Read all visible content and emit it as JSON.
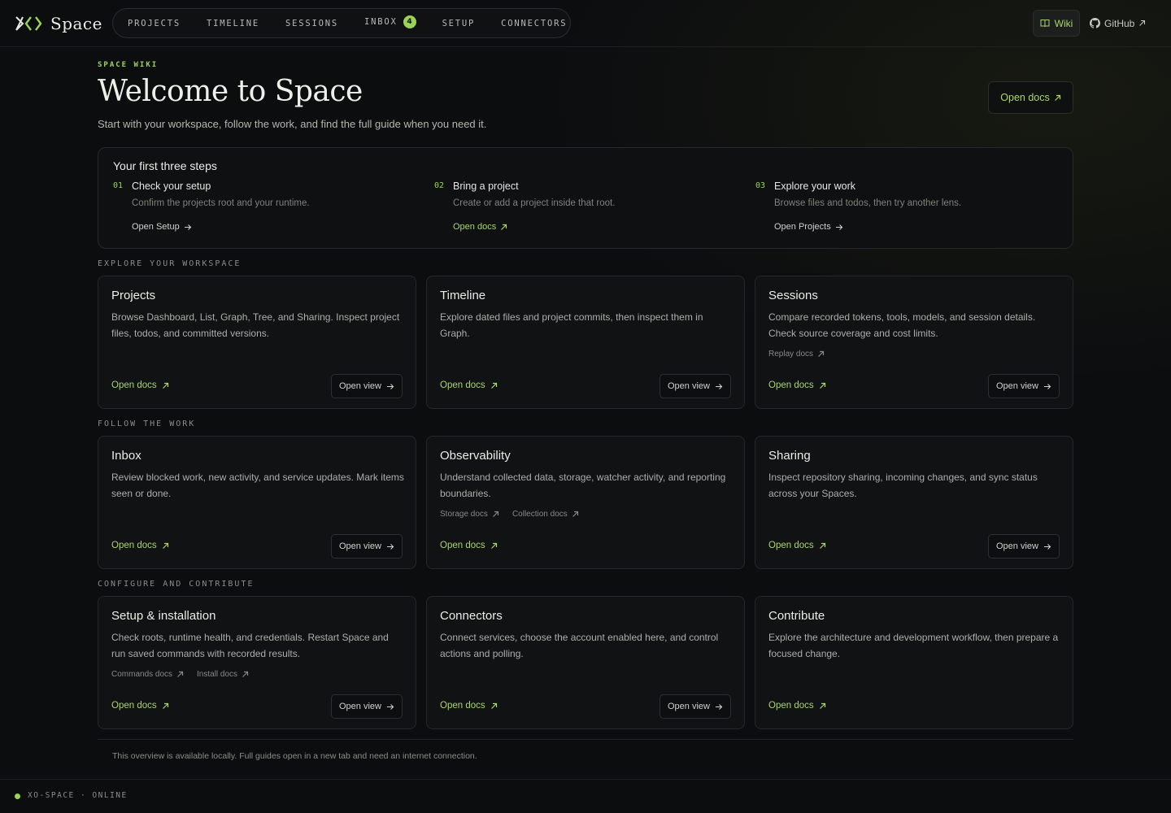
{
  "brand": {
    "name": "Space",
    "logo_icon": "xo-logo-icon"
  },
  "nav": {
    "items": [
      {
        "label": "PROJECTS"
      },
      {
        "label": "TIMELINE"
      },
      {
        "label": "SESSIONS"
      },
      {
        "label": "INBOX",
        "badge": "4"
      },
      {
        "label": "SETUP"
      },
      {
        "label": "CONNECTORS"
      }
    ],
    "wiki_label": "Wiki",
    "github_label": "GitHub"
  },
  "hero": {
    "eyebrow": "SPACE WIKI",
    "title": "Welcome to Space",
    "subtitle": "Start with your workspace, follow the work, and find the full guide when you need it.",
    "open_docs_label": "Open docs"
  },
  "steps": {
    "title": "Your first three steps",
    "items": [
      {
        "num": "01",
        "title": "Check your setup",
        "desc": "Confirm the projects root and your runtime.",
        "link": "Open Setup"
      },
      {
        "num": "02",
        "title": "Bring a project",
        "desc": "Create or add a project inside that root.",
        "link": "Open docs"
      },
      {
        "num": "03",
        "title": "Explore your work",
        "desc": "Browse files and todos, then try another lens.",
        "link": "Open Projects"
      }
    ]
  },
  "sections": [
    {
      "label": "EXPLORE YOUR WORKSPACE",
      "cards": [
        {
          "title": "Projects",
          "desc": "Browse Dashboard, List, Graph, Tree, and Sharing. Inspect project files, todos, and committed versions.",
          "sub": [],
          "docs": "Open docs",
          "view": "Open view"
        },
        {
          "title": "Timeline",
          "desc": "Explore dated files and project commits, then inspect them in Graph.",
          "sub": [],
          "docs": "Open docs",
          "view": "Open view"
        },
        {
          "title": "Sessions",
          "desc": "Compare recorded tokens, tools, models, and session details. Check source coverage and cost limits.",
          "sub": [
            "Replay docs"
          ],
          "docs": "Open docs",
          "view": "Open view"
        }
      ]
    },
    {
      "label": "FOLLOW THE WORK",
      "cards": [
        {
          "title": "Inbox",
          "desc": "Review blocked work, new activity, and service updates. Mark items seen or done.",
          "sub": [],
          "docs": "Open docs",
          "view": "Open view"
        },
        {
          "title": "Observability",
          "desc": "Understand collected data, storage, watcher activity, and reporting boundaries.",
          "sub": [
            "Storage docs",
            "Collection docs"
          ],
          "docs": "Open docs",
          "view": ""
        },
        {
          "title": "Sharing",
          "desc": "Inspect repository sharing, incoming changes, and sync status across your Spaces.",
          "sub": [],
          "docs": "Open docs",
          "view": "Open view"
        }
      ]
    },
    {
      "label": "CONFIGURE AND CONTRIBUTE",
      "cards": [
        {
          "title": "Setup & installation",
          "desc": "Check roots, runtime health, and credentials. Restart Space and run saved commands with recorded results.",
          "sub": [
            "Commands docs",
            "Install docs"
          ],
          "docs": "Open docs",
          "view": "Open view"
        },
        {
          "title": "Connectors",
          "desc": "Connect services, choose the account enabled here, and control actions and polling.",
          "sub": [],
          "docs": "Open docs",
          "view": "Open view"
        },
        {
          "title": "Contribute",
          "desc": "Explore the architecture and development workflow, then prepare a focused change.",
          "sub": [],
          "docs": "Open docs",
          "view": ""
        }
      ]
    }
  ],
  "footer": {
    "note": "This overview is available locally. Full guides open in a new tab and need an internet connection.",
    "status": "XO-SPACE · ONLINE"
  },
  "colors": {
    "accent": "#9bd356",
    "link": "#a9d66a",
    "background": "#0c0d0f",
    "card": "#111214"
  }
}
